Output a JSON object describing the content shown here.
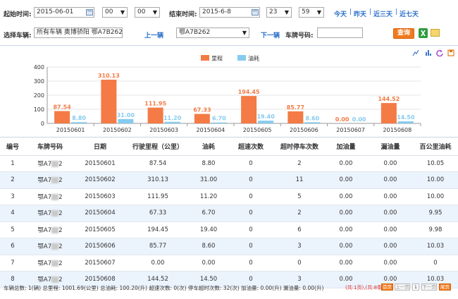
{
  "filters": {
    "start_label": "起始时间:",
    "start_date": "2015-06-01",
    "start_hour": "00",
    "start_min": "00",
    "end_label": "结束时间:",
    "end_date": "2015-6-8",
    "end_hour": "23",
    "end_min": "59",
    "quick_today": "今天",
    "quick_yesterday": "昨天",
    "quick_3days": "近三天",
    "quick_7days": "近七天",
    "vehicle_label": "选择车辆:",
    "vehicle_value": "所有车辆 奥博骄阳 鄂A7B262 鄂AF",
    "prev_link": "上一辆",
    "vehicle_select": "鄂A7B262",
    "next_link": "下一辆",
    "plate_label": "车牌号码:",
    "plate_value": "",
    "query_btn": "查询"
  },
  "chart_data": {
    "type": "bar",
    "categories": [
      "20150601",
      "20150602",
      "20150603",
      "20150604",
      "20150605",
      "20150606",
      "20150607",
      "20150608"
    ],
    "series": [
      {
        "name": "里程",
        "color": "#f47b45",
        "values": [
          87.54,
          310.13,
          111.95,
          67.33,
          194.45,
          85.77,
          0.0,
          144.52
        ],
        "labels": [
          "87.54",
          "310.13",
          "111.95",
          "67.33",
          "194.45",
          "85.77",
          "0.00",
          "144.52"
        ]
      },
      {
        "name": "油耗",
        "color": "#86cbef",
        "values": [
          8.8,
          31.0,
          11.2,
          6.7,
          19.4,
          8.6,
          0.0,
          14.5
        ],
        "labels": [
          "8.80",
          "31.00",
          "11.20",
          "6.70",
          "19.40",
          "8.60",
          "0.00",
          "14.50"
        ]
      }
    ],
    "yticks": [
      "0",
      "100",
      "200",
      "300",
      "400"
    ],
    "ylim": [
      0,
      400
    ],
    "grid": true,
    "legend": "top-center"
  },
  "table": {
    "headers": [
      "编号",
      "车牌号码",
      "日期",
      "行驶里程（公里）",
      "油耗",
      "超速次数",
      "超时停车次数",
      "加油量",
      "漏油量",
      "百公里油耗"
    ],
    "rows": [
      [
        "1",
        "鄂A7",
        "2",
        "20150601",
        "87.54",
        "8.80",
        "0",
        "2",
        "0.00",
        "0.00",
        "10.05"
      ],
      [
        "2",
        "鄂A7",
        "2",
        "20150602",
        "310.13",
        "31.00",
        "0",
        "11",
        "0.00",
        "0.00",
        "10.00"
      ],
      [
        "3",
        "鄂A7",
        "2",
        "20150603",
        "111.95",
        "11.20",
        "0",
        "5",
        "0.00",
        "0.00",
        "10.00"
      ],
      [
        "4",
        "鄂A7",
        "2",
        "20150604",
        "67.33",
        "6.70",
        "0",
        "2",
        "0.00",
        "0.00",
        "9.95"
      ],
      [
        "5",
        "鄂A7",
        "2",
        "20150605",
        "194.45",
        "19.40",
        "0",
        "6",
        "0.00",
        "0.00",
        "9.98"
      ],
      [
        "6",
        "鄂A7",
        "2",
        "20150606",
        "85.77",
        "8.60",
        "0",
        "3",
        "0.00",
        "0.00",
        "10.03"
      ],
      [
        "7",
        "鄂A7",
        "2",
        "20150607",
        "0.00",
        "0.00",
        "0",
        "0",
        "0.00",
        "0.00",
        "0"
      ],
      [
        "8",
        "鄂A7",
        "2",
        "20150608",
        "144.52",
        "14.50",
        "0",
        "3",
        "0.00",
        "0.00",
        "10.03"
      ]
    ]
  },
  "footer": {
    "summary": "车辆总数: 1(辆)  总里程: 1001.69(公里)  总油耗: 100.20(升)  超速次数: 0(次)  停车超时次数: 32(次)  加油量: 0.00(升)  漏油量: 0.00(升)",
    "page_info": "(共:1页),(共:8条)",
    "first": "首页",
    "prev": "上一页",
    "page_num": "1",
    "next": "下一页",
    "last": "尾页"
  }
}
